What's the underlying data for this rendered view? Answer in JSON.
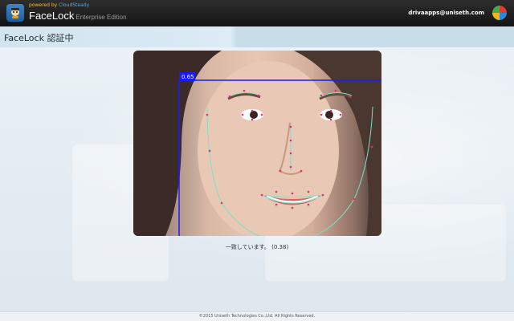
{
  "header": {
    "powered_prefix": "powered by",
    "powered_brand": "CloudSteady",
    "app_name": "FaceLock",
    "app_edition": "Enterprise Edition",
    "user_email": "drivaapps@uniseth.com",
    "app_logo_icon": "facelock-logo-icon",
    "user_logo_icon": "company-pinwheel-logo-icon"
  },
  "page": {
    "title": "FaceLock 認証中"
  },
  "camera": {
    "box_label": "0.65"
  },
  "status": {
    "message": "一致しています。 (0.38)"
  },
  "footer": {
    "copyright": "©2015 Uniseth Technologies Co.,Ltd. All Rights Reserved."
  },
  "colors": {
    "header_bg": "#1e1e1e",
    "title_band": "#d2e4ef",
    "detect_box": "#1a1aff",
    "landmark_line": "#7fe0c0",
    "landmark_point": "#e0307a"
  }
}
